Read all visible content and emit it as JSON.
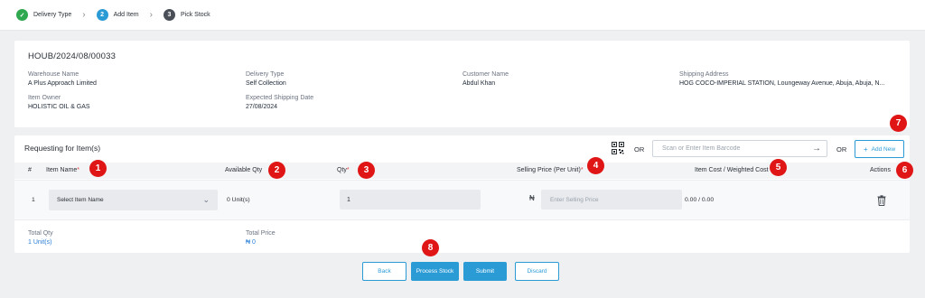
{
  "stepper": {
    "steps": [
      {
        "label": "Delivery Type",
        "number": "✓",
        "state": "done"
      },
      {
        "label": "Add Item",
        "number": "2",
        "state": "active"
      },
      {
        "label": "Pick Stock",
        "number": "3",
        "state": "pending"
      }
    ]
  },
  "header": {
    "reference": "HOUB/2024/08/00033",
    "fields": {
      "warehouse_name": {
        "label": "Warehouse Name",
        "value": "A Plus Approach Limited"
      },
      "delivery_type": {
        "label": "Delivery Type",
        "value": "Self Collection"
      },
      "customer_name": {
        "label": "Customer Name",
        "value": "Abdul Khan"
      },
      "shipping_address": {
        "label": "Shipping Address",
        "value": "HOG COCO-IMPERIAL STATION, Loungeway Avenue, Abuja, Abuja, N..."
      },
      "item_owner": {
        "label": "Item Owner",
        "value": "HOLISTIC OIL & GAS"
      },
      "expected_shipping_date": {
        "label": "Expected Shipping Date",
        "value": "27/08/2024"
      }
    }
  },
  "items": {
    "title": "Requesting for Item(s)",
    "or1": "OR",
    "or2": "OR",
    "barcode_placeholder": "Scan or Enter Item Barcode",
    "add_new_label": "Add New",
    "columns": {
      "index": "#",
      "item_name": "Item Name",
      "available_qty": "Available Qty",
      "qty": "Qty",
      "selling_price": "Selling Price (Per Unit)",
      "item_cost": "Item Cost / Weighted Cost",
      "actions": "Actions"
    },
    "required_mark": "*",
    "rows": [
      {
        "index": "1",
        "item_name": "Select Item Name",
        "available_qty": "0 Unit(s)",
        "qty": "1",
        "currency": "₦",
        "selling_price_placeholder": "Enter Selling Price",
        "item_cost": "0.00 / 0.00"
      }
    ],
    "total_qty_label": "Total Qty",
    "total_qty_value": "1 Unit(s)",
    "total_price_label": "Total Price",
    "total_price_value": "₦ 0"
  },
  "footer": {
    "back_label": "Back",
    "process_stock_label": "Process Stock",
    "submit_label": "Submit",
    "discard_label": "Discard"
  },
  "markers": [
    "1",
    "2",
    "3",
    "4",
    "5",
    "6",
    "7",
    "8"
  ],
  "colors": {
    "accent": "#2b9bd6",
    "done": "#2fa84f",
    "marker": "#e01515",
    "required": "#e23b3b"
  },
  "icons": [
    "check-icon",
    "chevron-right-icon",
    "qr-code-icon",
    "arrow-right-icon",
    "plus-icon",
    "chevron-down-icon",
    "trash-icon"
  ]
}
